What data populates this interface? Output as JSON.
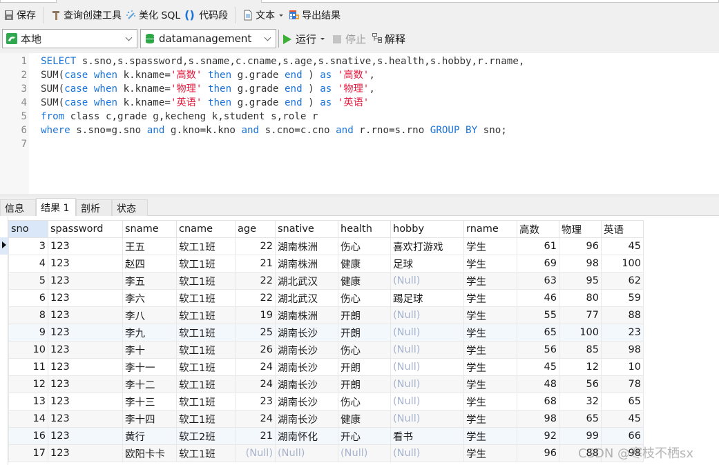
{
  "toolbar": {
    "save": "保存",
    "query_builder": "查询创建工具",
    "beautify_sql": "美化 SQL",
    "code_snippet": "代码段",
    "text": "文本",
    "export_result": "导出结果"
  },
  "connection_bar": {
    "connection": "本地",
    "database": "datamanagement",
    "run": "运行",
    "stop": "停止",
    "explain": "解释"
  },
  "editor": {
    "lines": [
      {
        "num": "1",
        "tokens": [
          [
            "kw",
            "SELECT"
          ],
          [
            "t",
            " s.sno,s.spassword,s.sname,c.cname,s.age,s.snative,s.health,s.hobby,r.rname,"
          ]
        ]
      },
      {
        "num": "2",
        "tokens": [
          [
            "t",
            "SUM("
          ],
          [
            "kw",
            "case"
          ],
          [
            "t",
            " "
          ],
          [
            "kw",
            "when"
          ],
          [
            "t",
            " k.kname="
          ],
          [
            "str",
            "'高数'"
          ],
          [
            "t",
            " "
          ],
          [
            "kw",
            "then"
          ],
          [
            "t",
            " g.grade "
          ],
          [
            "kw",
            "end"
          ],
          [
            "t",
            " ) "
          ],
          [
            "kw",
            "as"
          ],
          [
            "t",
            " "
          ],
          [
            "str",
            "'高数'"
          ],
          [
            "t",
            ","
          ]
        ]
      },
      {
        "num": "3",
        "tokens": [
          [
            "t",
            "SUM("
          ],
          [
            "kw",
            "case"
          ],
          [
            "t",
            " "
          ],
          [
            "kw",
            "when"
          ],
          [
            "t",
            " k.kname="
          ],
          [
            "str",
            "'物理'"
          ],
          [
            "t",
            " "
          ],
          [
            "kw",
            "then"
          ],
          [
            "t",
            " g.grade "
          ],
          [
            "kw",
            "end"
          ],
          [
            "t",
            " ) "
          ],
          [
            "kw",
            "as"
          ],
          [
            "t",
            " "
          ],
          [
            "str",
            "'物理'"
          ],
          [
            "t",
            ","
          ]
        ]
      },
      {
        "num": "4",
        "tokens": [
          [
            "t",
            "SUM("
          ],
          [
            "kw",
            "case"
          ],
          [
            "t",
            " "
          ],
          [
            "kw",
            "when"
          ],
          [
            "t",
            " k.kname="
          ],
          [
            "str",
            "'英语'"
          ],
          [
            "t",
            " "
          ],
          [
            "kw",
            "then"
          ],
          [
            "t",
            " g.grade "
          ],
          [
            "kw",
            "end"
          ],
          [
            "t",
            " ) "
          ],
          [
            "kw",
            "as"
          ],
          [
            "t",
            " "
          ],
          [
            "str",
            "'英语'"
          ]
        ]
      },
      {
        "num": "5",
        "tokens": [
          [
            "kw",
            "from"
          ],
          [
            "t",
            " class c,grade g,kecheng k,student s,role r"
          ]
        ]
      },
      {
        "num": "6",
        "tokens": [
          [
            "kw",
            "where"
          ],
          [
            "t",
            " s.sno=g.sno "
          ],
          [
            "kw",
            "and"
          ],
          [
            "t",
            " g.kno=k.kno "
          ],
          [
            "kw",
            "and"
          ],
          [
            "t",
            " s.cno=c.cno "
          ],
          [
            "kw",
            "and"
          ],
          [
            "t",
            " r.rno=s.rno "
          ],
          [
            "kw",
            "GROUP BY"
          ],
          [
            "t",
            " sno;"
          ]
        ]
      },
      {
        "num": "7",
        "tokens": []
      }
    ]
  },
  "result_tabs": [
    {
      "label": "信息",
      "active": false
    },
    {
      "label": "结果 1",
      "active": true
    },
    {
      "label": "剖析",
      "active": false
    },
    {
      "label": "状态",
      "active": false
    }
  ],
  "grid": {
    "columns": [
      "sno",
      "spassword",
      "sname",
      "cname",
      "age",
      "snative",
      "health",
      "hobby",
      "rname",
      "高数",
      "物理",
      "英语"
    ],
    "null_text": "(Null)",
    "rows": [
      [
        "3",
        "123",
        "王五",
        "软工1班",
        "22",
        "湖南株洲",
        "伤心",
        "喜欢打游戏",
        "学生",
        "61",
        "96",
        "45"
      ],
      [
        "4",
        "123",
        "赵四",
        "软工1班",
        "21",
        "湖南株洲",
        "健康",
        "足球",
        "学生",
        "69",
        "98",
        "100"
      ],
      [
        "5",
        "123",
        "李五",
        "软工1班",
        "22",
        "湖北武汉",
        "健康",
        null,
        "学生",
        "63",
        "95",
        "62"
      ],
      [
        "6",
        "123",
        "李六",
        "软工1班",
        "22",
        "湖北武汉",
        "伤心",
        "踢足球",
        "学生",
        "46",
        "80",
        "59"
      ],
      [
        "8",
        "123",
        "李八",
        "软工1班",
        "19",
        "湖南株洲",
        "开朗",
        null,
        "学生",
        "55",
        "77",
        "88"
      ],
      [
        "9",
        "123",
        "李九",
        "软工1班",
        "25",
        "湖南长沙",
        "开朗",
        null,
        "学生",
        "65",
        "100",
        "23"
      ],
      [
        "10",
        "123",
        "李十",
        "软工1班",
        "26",
        "湖南长沙",
        "伤心",
        null,
        "学生",
        "56",
        "85",
        "98"
      ],
      [
        "11",
        "123",
        "李十一",
        "软工1班",
        "24",
        "湖南长沙",
        "开朗",
        null,
        "学生",
        "45",
        "12",
        "10"
      ],
      [
        "12",
        "123",
        "李十二",
        "软工1班",
        "24",
        "湖南长沙",
        "开朗",
        null,
        "学生",
        "48",
        "56",
        "78"
      ],
      [
        "13",
        "123",
        "李十三",
        "软工1班",
        "23",
        "湖南长沙",
        "伤心",
        null,
        "学生",
        "68",
        "32",
        "65"
      ],
      [
        "14",
        "123",
        "李十四",
        "软工1班",
        "24",
        "湖南长沙",
        "健康",
        null,
        "学生",
        "98",
        "65",
        "45"
      ],
      [
        "16",
        "123",
        "黄行",
        "软工2班",
        "21",
        "湖南怀化",
        "开心",
        "看书",
        "学生",
        "92",
        "99",
        "66"
      ],
      [
        "17",
        "123",
        "欧阳卡卡",
        "软工1班",
        null,
        null,
        null,
        null,
        "学生",
        "96",
        "88",
        "98"
      ]
    ]
  },
  "watermark": "CSDN @寒枝不栖sx",
  "colors": {
    "keyword": "#1a73d9",
    "string": "#e3183d",
    "null": "#a7b3cc",
    "run_green": "#3cb034",
    "selection": "#d9e7f8"
  }
}
